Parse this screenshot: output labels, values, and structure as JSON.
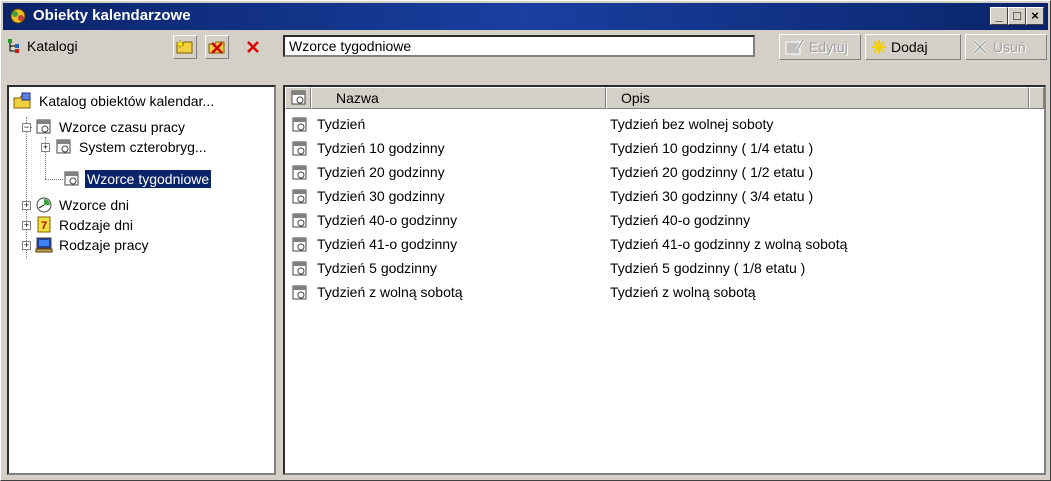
{
  "window": {
    "title": "Obiekty kalendarzowe",
    "controls": [
      "_",
      "□",
      "×"
    ]
  },
  "left_toolbar": {
    "label": "Katalogi"
  },
  "right_toolbar": {
    "path": "Wzorce tygodniowe",
    "edit_label": "Edytuj",
    "add_label": "Dodaj",
    "delete_label": "Usuń"
  },
  "tree": {
    "root": "Katalog obiektów kalendar...",
    "work_time_patterns": "Wzorce czasu pracy",
    "four_brigade": "System czterobryg...",
    "weekly_patterns": "Wzorce tygodniowe",
    "day_patterns": "Wzorce dni",
    "day_types": "Rodzaje dni",
    "work_types": "Rodzaje pracy"
  },
  "table": {
    "headers": {
      "name": "Nazwa",
      "description": "Opis"
    },
    "rows": [
      {
        "name": "Tydzień",
        "description": "Tydzień bez wolnej soboty"
      },
      {
        "name": "Tydzień 10 godzinny",
        "description": "Tydzień 10 godzinny ( 1/4 etatu )"
      },
      {
        "name": "Tydzień 20 godzinny",
        "description": "Tydzień 20 godzinny ( 1/2 etatu )"
      },
      {
        "name": "Tydzień 30 godzinny",
        "description": "Tydzień 30 godzinny ( 3/4 etatu )"
      },
      {
        "name": "Tydzień 40-o godzinny",
        "description": "Tydzień 40-o godzinny"
      },
      {
        "name": "Tydzień 41-o godzinny",
        "description": "Tydzień 41-o godzinny z wolną sobotą"
      },
      {
        "name": "Tydzień 5 godzinny",
        "description": "Tydzień 5 godzinny ( 1/8 etatu )"
      },
      {
        "name": "Tydzień z wolną sobotą",
        "description": "Tydzień z wolną sobotą"
      }
    ]
  },
  "colors": {
    "titlebar": "#0a246a",
    "selection": "#0a246a",
    "face": "#d4d0c8"
  }
}
